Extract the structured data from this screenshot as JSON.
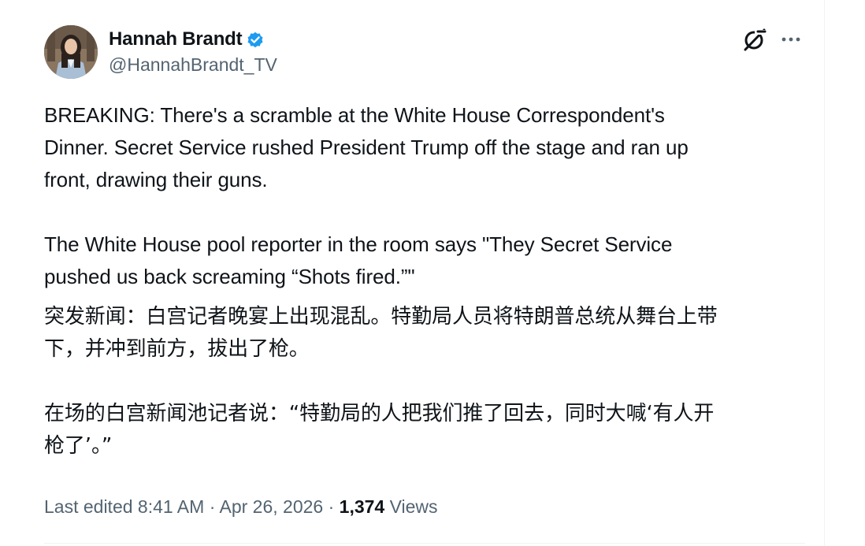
{
  "author": {
    "display_name": "Hannah Brandt",
    "handle": "@HannahBrandt_TV",
    "verified": true,
    "verified_color": "#1d9bf0"
  },
  "icons": {
    "grok": "grok-icon",
    "more": "more-options-icon",
    "verified": "verified-badge-icon"
  },
  "tweet": {
    "en_para_1_line_1": "BREAKING: There's a scramble at the White House Correspondent's",
    "en_para_1_line_2": "Dinner. Secret Service rushed President Trump off the stage and ran up",
    "en_para_1_line_3": "front, drawing their guns.",
    "en_para_2_line_1": "The White House pool reporter in the room says \"They Secret Service",
    "en_para_2_line_2": "pushed us back screaming “Shots fired.”\"",
    "zh_para_1_line_1": "突发新闻：白宫记者晚宴上出现混乱。特勤局人员将特朗普总统从舞台上带",
    "zh_para_1_line_2": "下，并冲到前方，拔出了枪。",
    "zh_para_2_line_1": "在场的白宫新闻池记者说：“特勤局的人把我们推了回去，同时大喊‘有人开",
    "zh_para_2_line_2": "枪了’。”"
  },
  "meta": {
    "edited_label": "Last edited 8:41 AM",
    "separator_1": " · ",
    "date": "Apr 26, 2026",
    "separator_2": " · ",
    "views_count": "1,374",
    "views_label": " Views"
  },
  "colors": {
    "text_primary": "#0f1419",
    "text_secondary": "#536471",
    "border": "#eff3f4"
  }
}
